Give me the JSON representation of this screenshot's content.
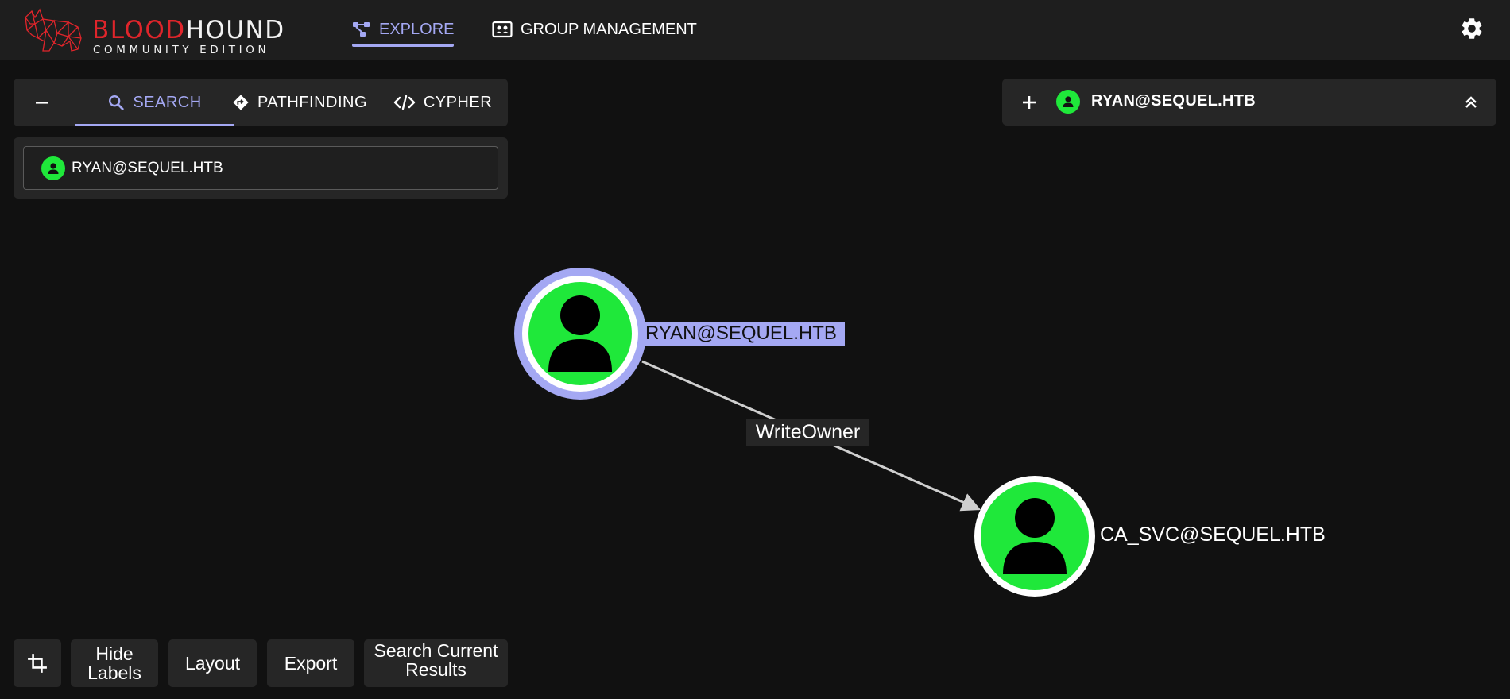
{
  "brand": {
    "title_red": "BLOOD",
    "title_white": "HOUND",
    "subtitle": "COMMUNITY EDITION",
    "accent_red": "#e0252b"
  },
  "nav": {
    "explore": "EXPLORE",
    "group_management": "GROUP MANAGEMENT",
    "active_color": "#a4a8f3"
  },
  "search_panel": {
    "tabs": {
      "search": "SEARCH",
      "pathfinding": "PATHFINDING",
      "cypher": "CYPHER"
    },
    "selected_node": "RYAN@SEQUEL.HTB"
  },
  "details": {
    "title": "RYAN@SEQUEL.HTB"
  },
  "graph": {
    "nodes": [
      {
        "label": "RYAN@SEQUEL.HTB",
        "type": "User",
        "selected": true
      },
      {
        "label": "CA_SVC@SEQUEL.HTB",
        "type": "User",
        "selected": false
      }
    ],
    "edge": {
      "label": "WriteOwner",
      "from": "RYAN@SEQUEL.HTB",
      "to": "CA_SVC@SEQUEL.HTB"
    },
    "user_color": "#1fe83a"
  },
  "bottom_bar": {
    "hide_labels": "Hide Labels",
    "layout": "Layout",
    "export": "Export",
    "search_current_results": "Search Current Results"
  }
}
